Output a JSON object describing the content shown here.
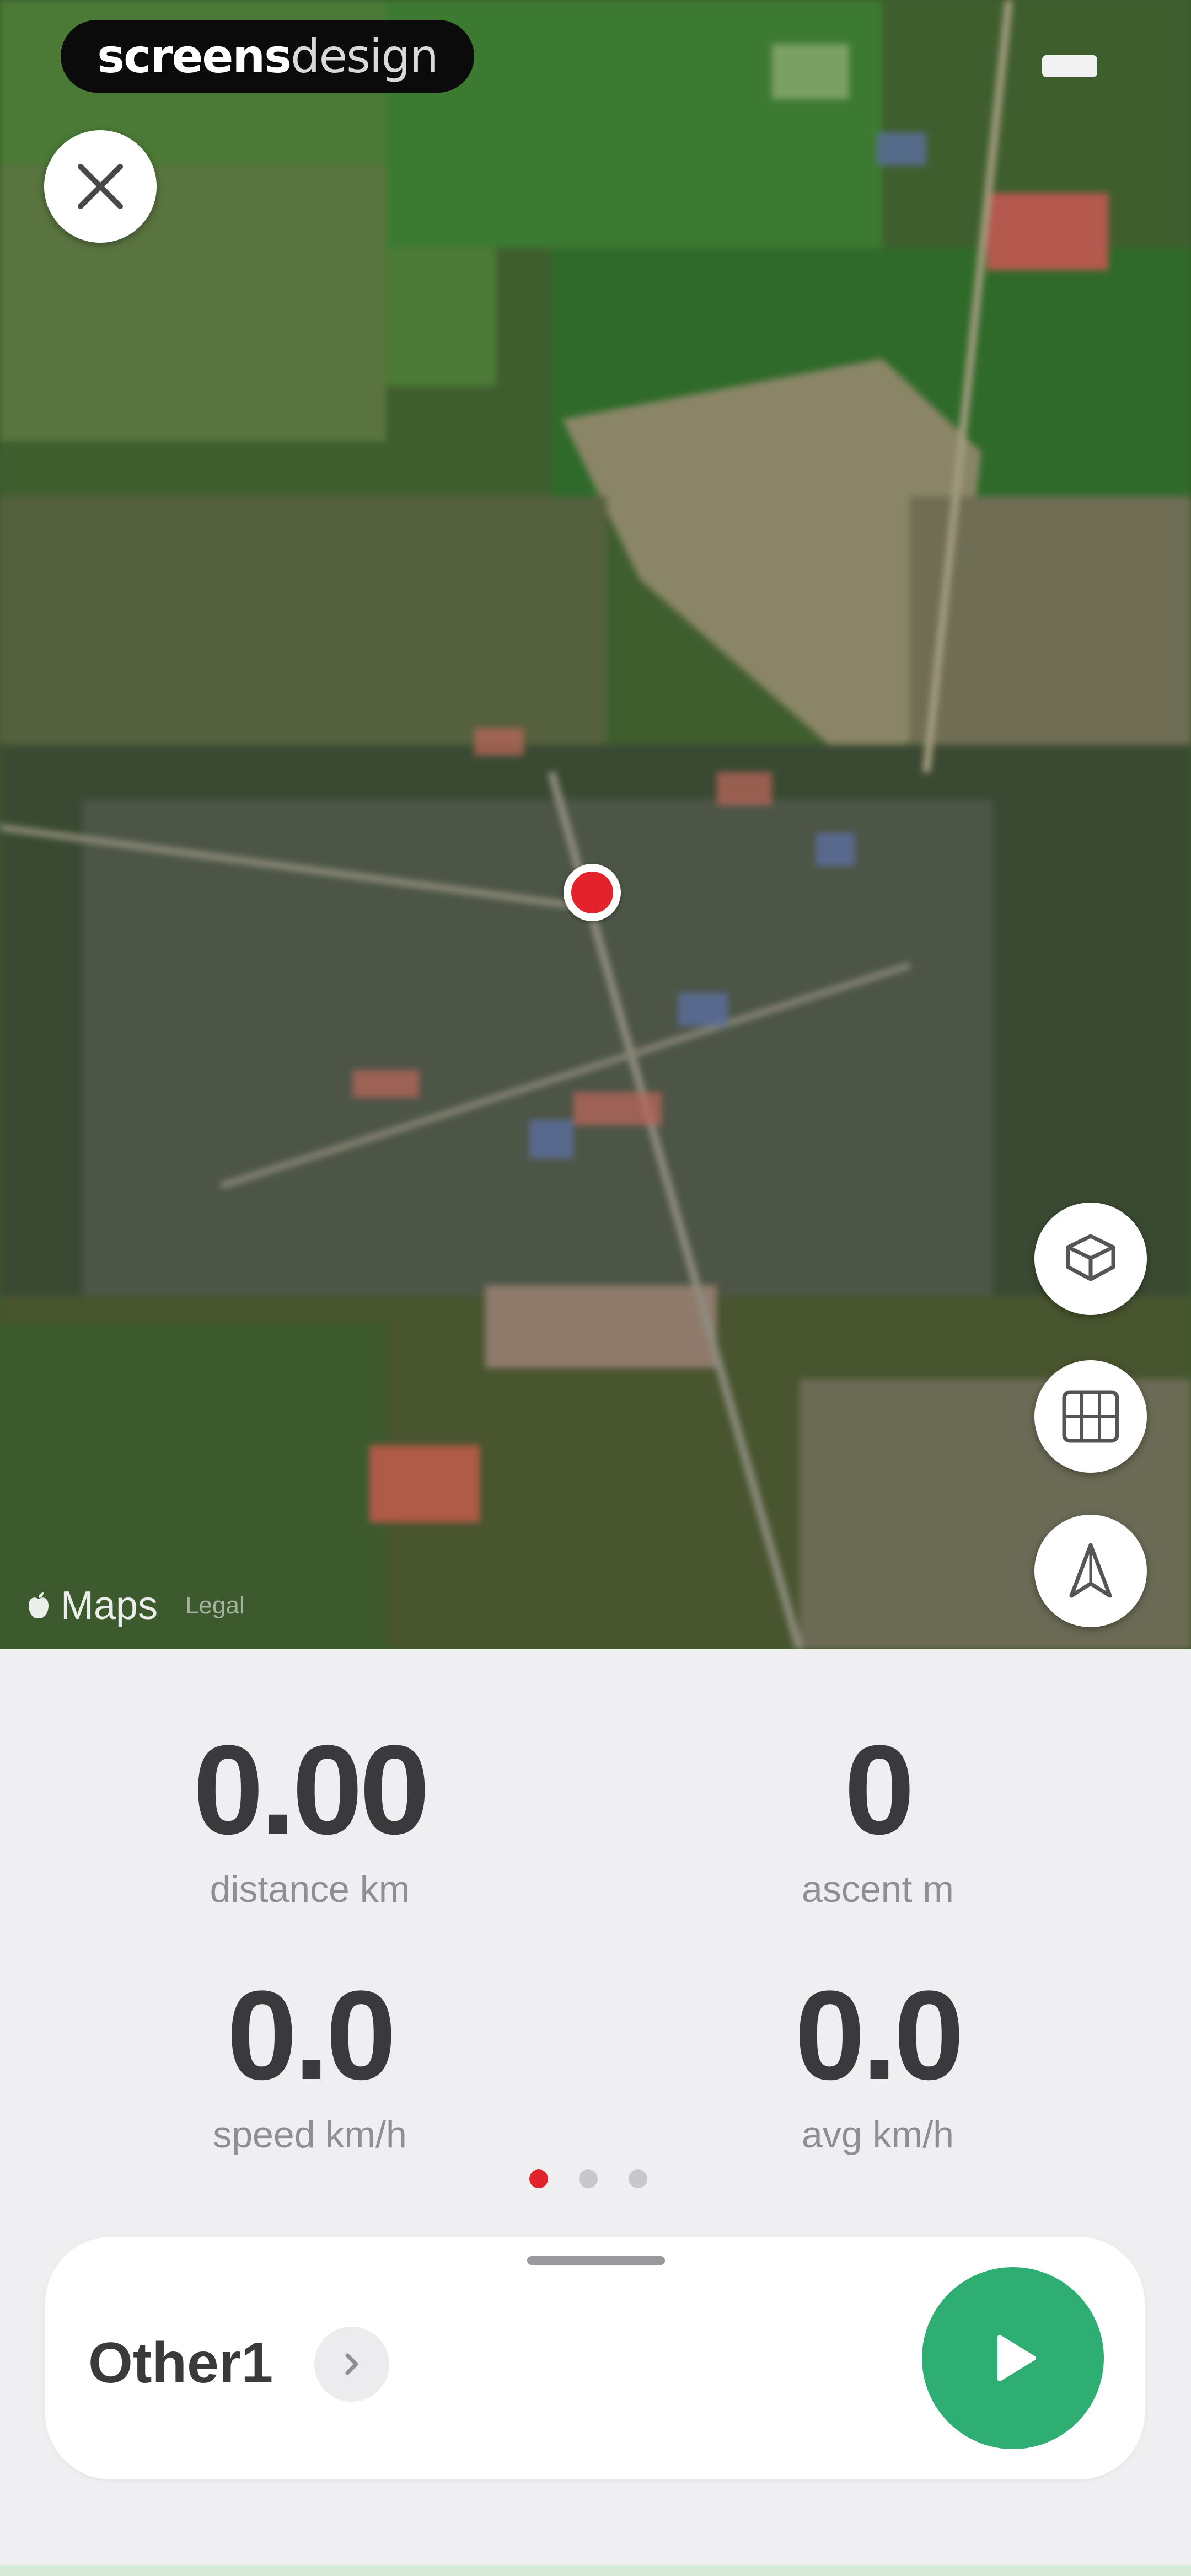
{
  "brand": {
    "part1": "screens",
    "part2": "design"
  },
  "map": {
    "attribution": "Maps",
    "legal": "Legal",
    "buttons": {
      "close": "close-icon",
      "layers": "layers-icon",
      "map_type": "map-icon",
      "tracking": "location-arrow-icon"
    },
    "user_location_color": "#e3232b"
  },
  "stats": [
    {
      "value": "0.00",
      "label": "distance km"
    },
    {
      "value": "0",
      "label": "ascent m"
    },
    {
      "value": "0.0",
      "label": "speed km/h"
    },
    {
      "value": "0.0",
      "label": "avg km/h"
    }
  ],
  "pager": {
    "count": 3,
    "active_index": 0
  },
  "activity": {
    "name": "Other1",
    "start_color": "#2fae73"
  }
}
